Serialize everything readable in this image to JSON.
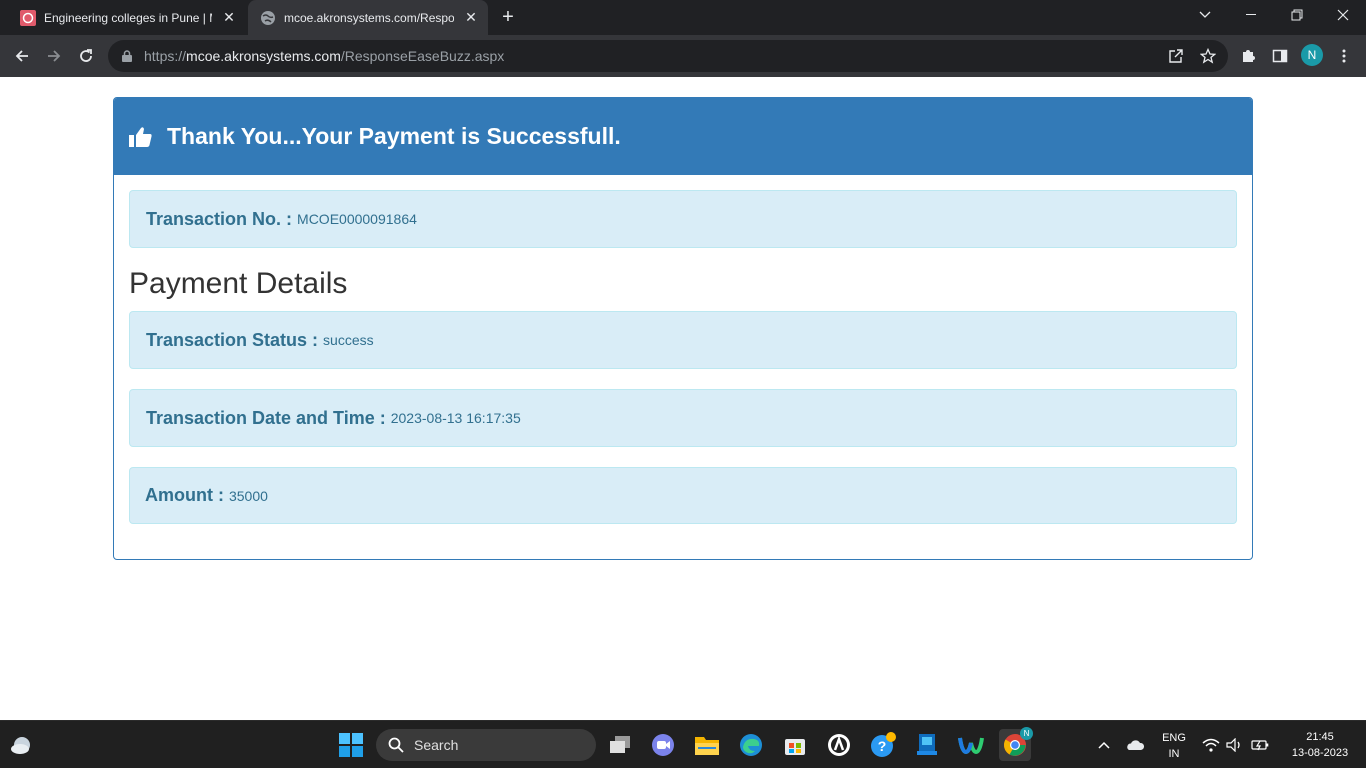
{
  "browser": {
    "tabs": [
      {
        "title": "Engineering colleges in Pune | M",
        "active": false
      },
      {
        "title": "mcoe.akronsystems.com/Respon",
        "active": true
      }
    ],
    "url_prefix": "https://",
    "url_host": "mcoe.akronsystems.com",
    "url_path": "/ResponseEaseBuzz.aspx",
    "profile_initial": "N"
  },
  "page": {
    "heading": "Thank You...Your Payment is Successfull.",
    "transaction_no_label": "Transaction No. :",
    "transaction_no_value": "MCOE0000091864",
    "section_title": "Payment Details",
    "status_label": "Transaction Status :",
    "status_value": "success",
    "datetime_label": "Transaction Date and Time :",
    "datetime_value": "2023-08-13 16:17:35",
    "amount_label": "Amount :",
    "amount_value": "35000"
  },
  "taskbar": {
    "search_label": "Search",
    "lang_line1": "ENG",
    "lang_line2": "IN",
    "time": "21:45",
    "date": "13-08-2023",
    "chrome_badge": "N"
  },
  "colors": {
    "panel_primary": "#337ab7",
    "alert_bg": "#d9edf7",
    "alert_text": "#31708f"
  }
}
